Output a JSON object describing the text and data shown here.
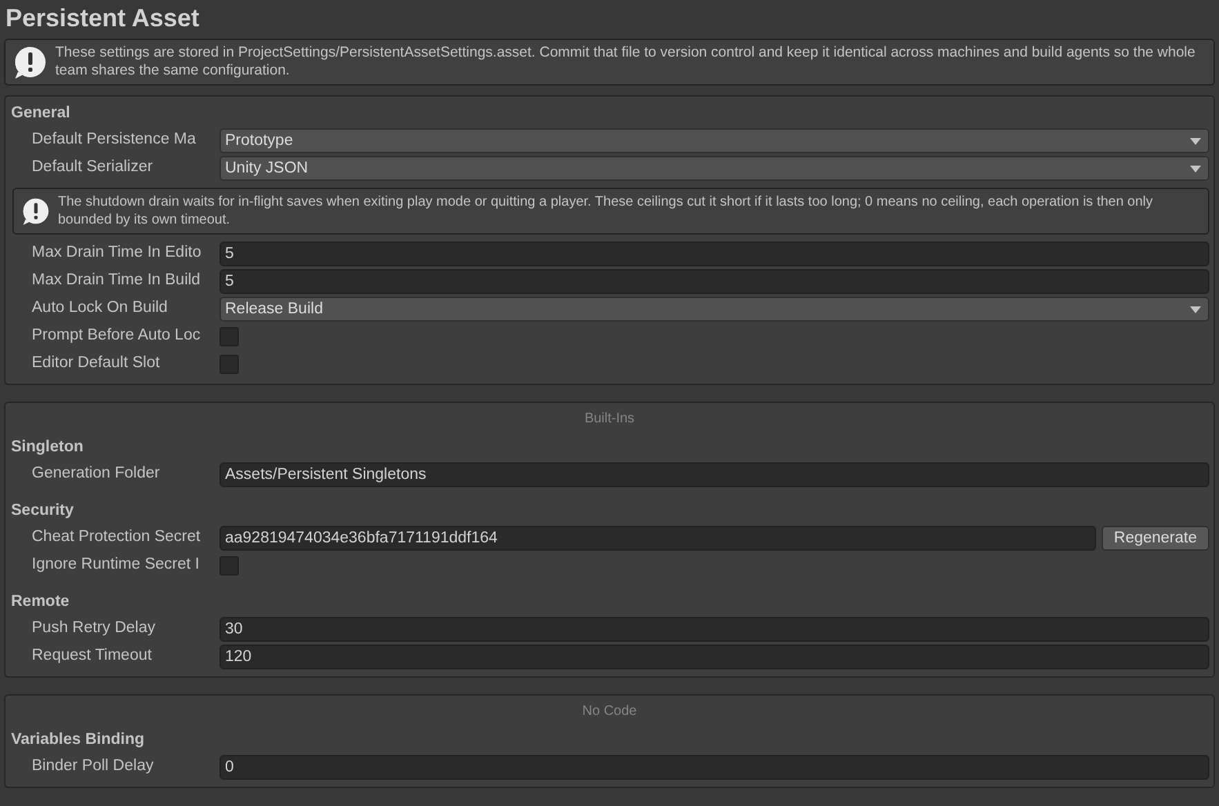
{
  "title": "Persistent Asset",
  "help": "These settings are stored in ProjectSettings/PersistentAssetSettings.asset. Commit that file to version control and keep it identical across machines and build agents so the whole team shares the same configuration.",
  "panels": [
    {
      "groups": [
        {
          "header": "General",
          "rows": [
            {
              "kind": "dropdown",
              "label": "Default Persistence Ma",
              "value": "Prototype"
            },
            {
              "kind": "dropdown",
              "label": "Default Serializer",
              "value": "Unity JSON"
            },
            {
              "kind": "help",
              "text": "The shutdown drain waits for in-flight saves when exiting play mode or quitting a player. These ceilings cut it short if it lasts too long; 0 means no ceiling, each operation is then only bounded by its own timeout."
            },
            {
              "kind": "field",
              "label": "Max Drain Time In Edito",
              "value": "5"
            },
            {
              "kind": "field",
              "label": "Max Drain Time In Build",
              "value": "5"
            },
            {
              "kind": "dropdown",
              "label": "Auto Lock On Build",
              "value": "Release Build"
            },
            {
              "kind": "checkbox",
              "label": "Prompt Before Auto Loc",
              "checked": false
            },
            {
              "kind": "checkbox",
              "label": "Editor Default Slot",
              "checked": false
            }
          ]
        }
      ]
    },
    {
      "caption": "Built-Ins",
      "groups": [
        {
          "header": "Singleton",
          "rows": [
            {
              "kind": "field",
              "label": "Generation Folder",
              "value": "Assets/Persistent Singletons"
            }
          ]
        },
        {
          "header": "Security",
          "rows": [
            {
              "kind": "field_button",
              "label": "Cheat Protection Secret",
              "value": "aa92819474034e36bfa7171191ddf164",
              "button": "Regenerate"
            },
            {
              "kind": "checkbox",
              "label": "Ignore Runtime Secret I",
              "checked": false
            }
          ]
        },
        {
          "header": "Remote",
          "rows": [
            {
              "kind": "field",
              "label": "Push Retry Delay",
              "value": "30"
            },
            {
              "kind": "field",
              "label": "Request Timeout",
              "value": "120"
            }
          ]
        }
      ]
    },
    {
      "caption": "No Code",
      "groups": [
        {
          "header": "Variables Binding",
          "rows": [
            {
              "kind": "field",
              "label": "Binder Poll Delay",
              "value": "0"
            }
          ]
        }
      ]
    }
  ]
}
